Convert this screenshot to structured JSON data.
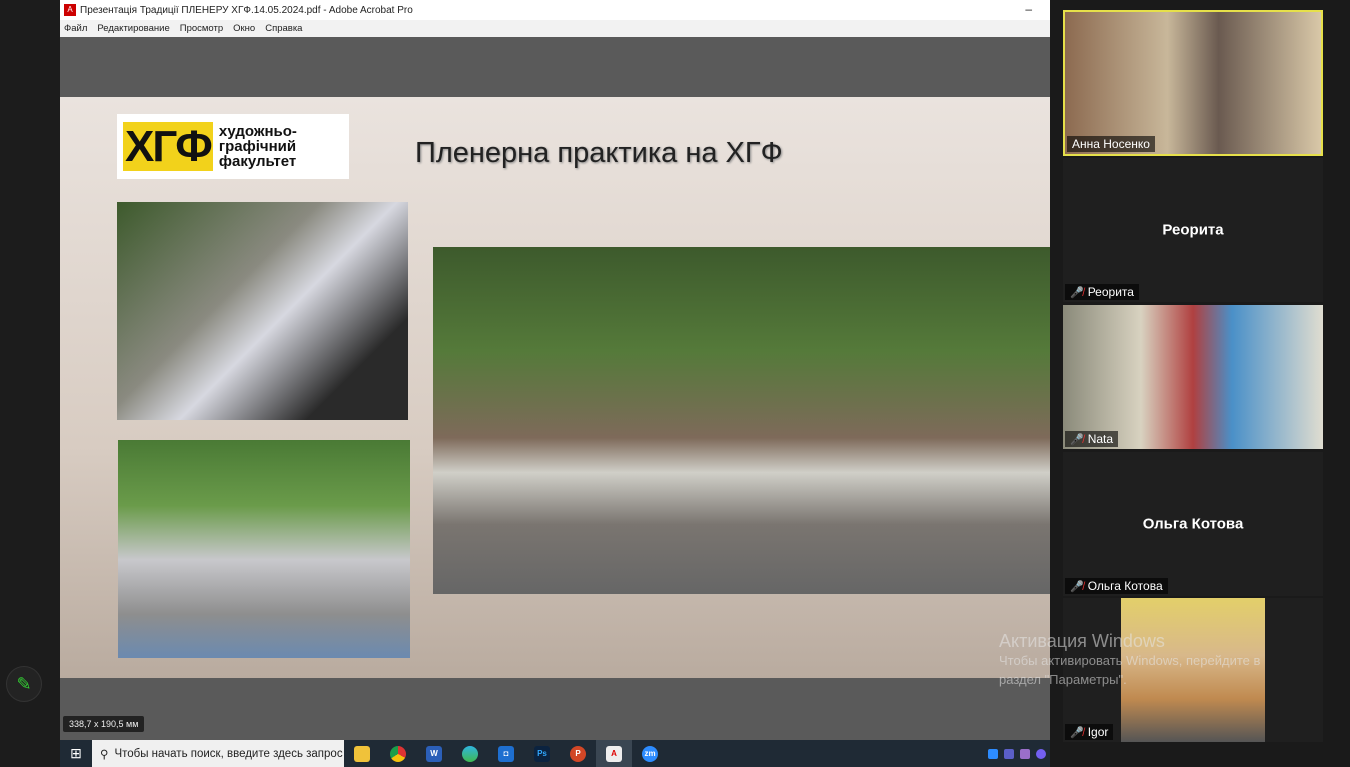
{
  "window": {
    "title": "Презентація Традиції ПЛЕНЕРУ ХГФ.14.05.2024.pdf - Adobe Acrobat Pro",
    "minimize": "–"
  },
  "menu": [
    "Файл",
    "Редактирование",
    "Просмотр",
    "Окно",
    "Справка"
  ],
  "slide": {
    "logo_mark": "ХГФ",
    "logo_text": [
      "художньо-",
      "графічний",
      "факультет"
    ],
    "title": "Пленерна практика на ХГФ"
  },
  "status_dimensions": "338,7 x 190,5 мм",
  "taskbar": {
    "search_placeholder": "Чтобы начать поиск, введите здесь запрос",
    "apps": [
      "file-explorer",
      "chrome",
      "word",
      "edge",
      "camera",
      "photoshop",
      "powerpoint",
      "acrobat",
      "zoom"
    ]
  },
  "participants": [
    {
      "name": "Анна Носенко",
      "video": true,
      "active_speaker": true
    },
    {
      "name": "Реорита",
      "video": false,
      "muted": true
    },
    {
      "name": "Nata",
      "video": true,
      "muted": true
    },
    {
      "name": "Ольга Котова",
      "video": false,
      "muted": true
    },
    {
      "name": "Igor",
      "video": true,
      "muted": true
    }
  ],
  "watermark": {
    "title": "Активация Windows",
    "line1": "Чтобы активировать Windows, перейдите в",
    "line2": "раздел \"Параметры\"."
  },
  "colors": {
    "accent_speaker": "#e6e04a",
    "logo_yellow": "#f2d21b",
    "mute": "#e33333"
  }
}
